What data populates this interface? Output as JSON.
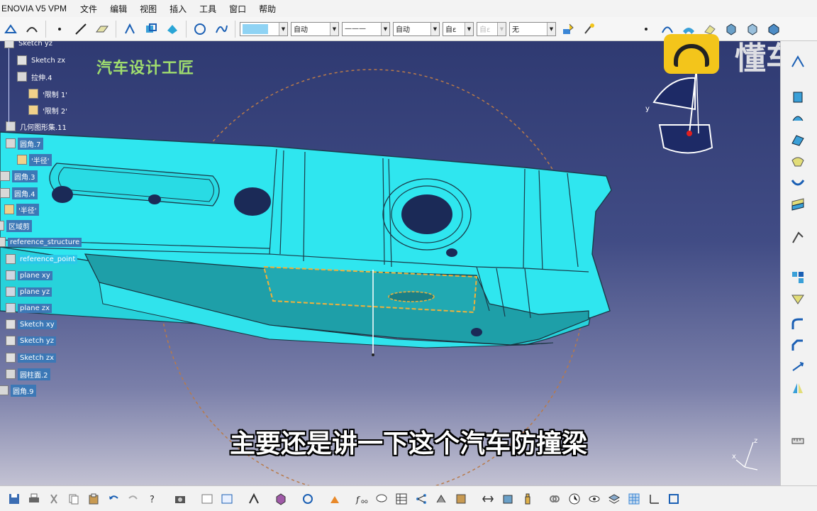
{
  "app": {
    "title": "ENOVIA V5 VPM",
    "menu": [
      "文件",
      "编辑",
      "视图",
      "插入",
      "工具",
      "窗口",
      "帮助"
    ]
  },
  "toolbar": {
    "dropdowns": [
      "",
      "自动",
      "———",
      "自动",
      "自ε",
      "自ε",
      "无"
    ]
  },
  "tree": {
    "items": [
      {
        "label": "Sketch yz",
        "icon": "sketch-icon"
      },
      {
        "label": "Sketch zx",
        "icon": "sketch-icon"
      },
      {
        "label": "拉伸.4",
        "icon": "extrude-icon"
      },
      {
        "label": "'限制 1'",
        "icon": "limit-icon"
      },
      {
        "label": "'限制 2'",
        "icon": "limit-icon"
      },
      {
        "label": "几何图形集.11",
        "icon": "geometric-set-icon"
      },
      {
        "label": "圆角.7",
        "icon": "fillet-icon"
      },
      {
        "label": "'半径'",
        "icon": "parameter-icon"
      },
      {
        "label": "圆角.3",
        "icon": "fillet-icon"
      },
      {
        "label": "圆角.4",
        "icon": "fillet-icon"
      },
      {
        "label": "'半径'",
        "icon": "parameter-icon"
      },
      {
        "label": "区域剪",
        "icon": "trim-icon"
      },
      {
        "label": "reference_structure",
        "icon": "geometric-set-icon"
      },
      {
        "label": "reference_point",
        "icon": "point-icon"
      },
      {
        "label": "plane xy",
        "icon": "plane-icon"
      },
      {
        "label": "plane yz",
        "icon": "plane-icon"
      },
      {
        "label": "plane zx",
        "icon": "plane-icon"
      },
      {
        "label": "Sketch xy",
        "icon": "sketch-icon"
      },
      {
        "label": "Sketch yz",
        "icon": "sketch-icon"
      },
      {
        "label": "Sketch zx",
        "icon": "sketch-icon"
      },
      {
        "label": "圆柱面.2",
        "icon": "cylinder-icon"
      },
      {
        "label": "圆角.9",
        "icon": "fillet-icon"
      }
    ]
  },
  "overlay": {
    "watermark": "汽车设计工匠",
    "subtitle": "主要还是讲一下这个汽车防撞梁",
    "brand_text": "懂车"
  },
  "compass": {
    "z_label": "z",
    "y_label": "y"
  },
  "axis_triad": {
    "z": "z",
    "x": "x"
  }
}
